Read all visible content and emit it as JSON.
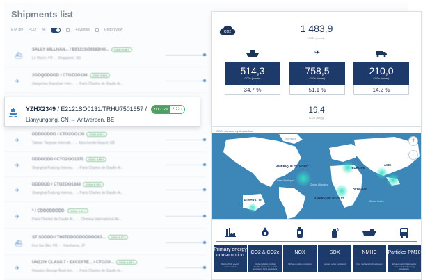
{
  "list": {
    "title": "Shipments list",
    "filters": {
      "period": "ETA diff",
      "mode": "POD",
      "toggle_label": "All",
      "favorites": "Favorites",
      "report": "Report view"
    },
    "rows": [
      {
        "id": "SALLY MILLHAN...",
        "ref": "/ E0121SO0162HH...",
        "route_from": "Le Havre, FR",
        "route_to": "Singapore, SG",
        "pill": "CO2e 4.89 t",
        "icon": "ship"
      },
      {
        "id": "2GDQGDDDD",
        "ref": "/ CTOZOO136",
        "route_from": "Hangzhou Xiaoshan Inter...",
        "route_to": "Paris Charles de Gaulle Ai...",
        "pill": "CO2e 0.82 t",
        "icon": "plane"
      },
      {
        "id": "YZHX2349",
        "ref": "/ E2121SO0131/TRHU7501657 /",
        "route_from": "Lianyungang, CN",
        "route_to": "Antwerpen, BE",
        "pill": "2.22 t",
        "icon": "ship"
      },
      {
        "id": "DDDDDDDD",
        "ref": "/ CTOZOO135",
        "route_from": "Taiwan Taoyuan Internati...",
        "route_to": "Manchester Airport, GB",
        "pill": "CO2e 0.31 t",
        "icon": "plane"
      },
      {
        "id": "DDDDDDD",
        "ref": "/ CTOZOO1375",
        "route_from": "Shanghai Pudong Interna...",
        "route_to": "Paris Charles de Gaulle Ai...",
        "pill": "CO2e 0.90 t",
        "icon": "plane"
      },
      {
        "id": "DDDDDD",
        "ref": "/ CTOZOO1343",
        "route_from": "Shanghai Pudong Interna...",
        "route_to": "Paris Charles de Gaulle Ai...",
        "pill": "CO2e 0.74 t",
        "icon": "plane"
      },
      {
        "id": "* / CDDDDDDDD",
        "ref": "",
        "route_from": "Paris Charles de Gaulle Ai...",
        "route_to": "Chennai International Air...",
        "pill": "CO2e 0.41 t",
        "icon": "plane"
      },
      {
        "id": "ST SDDDD",
        "ref": "/ TH3TDDDDDDDDDD63...",
        "route_from": "Fos Sur Mer, FR",
        "route_to": "Yokohama, JP",
        "pill": "CO2e 3.17 t",
        "icon": "ship"
      },
      {
        "id": "UNZZIY CLASS 7 - EXCEPTE...",
        "ref": "/ CTOZO...",
        "route_from": "Houston George Bush Int...",
        "route_to": "Paris Charles de Gaulle Ai...",
        "pill": "CO2e 1.05 t",
        "icon": "plane"
      }
    ]
  },
  "focused": {
    "id": "YZHX2349",
    "refs": " / E2121SO0131/TRHU7501657 /",
    "pill_label": "CO2e",
    "pill_value": "2,22 t",
    "from": "Lianyungang, CN",
    "to": "Antwerpen, BE",
    "arrow": "→"
  },
  "emissions": {
    "badge": "CO2",
    "total": "1 483,9",
    "total_label": "CO2e (tonnes)",
    "modes": [
      {
        "name": "sea",
        "icon": "ship-icon",
        "value": "514,3",
        "unit": "CO2e (tonnes)",
        "share": "34,7 %"
      },
      {
        "name": "air",
        "icon": "plane-icon",
        "value": "758,5",
        "unit": "CO2e (tonnes)",
        "share": "51,1 %"
      },
      {
        "name": "road",
        "icon": "truck-icon",
        "value": "210,0",
        "unit": "CO2e (tonnes)",
        "share": "14,2 %"
      }
    ],
    "intensity": "19,4",
    "intensity_label": "CO2e / teu (g)"
  },
  "map": {
    "title": "CO2e (tonnes) by destination",
    "zoom_in": "+",
    "zoom_out": "−",
    "labels": [
      "AMÉRIQUE DU NORD",
      "EUROPE",
      "ASIE",
      "AFRIQUE",
      "AMÉRIQUE DU SUD",
      "AUSTRALIE",
      "Océan Pacifique",
      "Océan Atlantique",
      "Océan Indien",
      "Groenland"
    ]
  },
  "pollutants": [
    {
      "name": "Primary energy consumption",
      "desc": "Well to Tank energy consumption",
      "icon": "factory-icon"
    },
    {
      "name": "CO2 & CO2e",
      "desc": "CO2e includes Carbon dioxide emissions & CH4 emissions N2O emissions",
      "icon": "drop-icon"
    },
    {
      "name": "NOX",
      "desc": "Nitrogen oxide emissions",
      "icon": "canister-icon"
    },
    {
      "name": "SOX",
      "desc": "Sulphur oxide emissions",
      "icon": "spray-icon"
    },
    {
      "name": "NMHC",
      "desc": "Non methane hydrocarbons",
      "icon": "ship-icon"
    },
    {
      "name": "Particles PM10",
      "desc": "Exhaust particulate matter from vehicles & energy production",
      "icon": "bus-icon"
    }
  ],
  "colors": {
    "navy": "#1d3a6b",
    "accent_blue": "#3a7fc2",
    "green": "#4f9f63",
    "map_land": "#ffffff",
    "map_sea": "#3d86b8",
    "heat": "#36e0c8"
  }
}
